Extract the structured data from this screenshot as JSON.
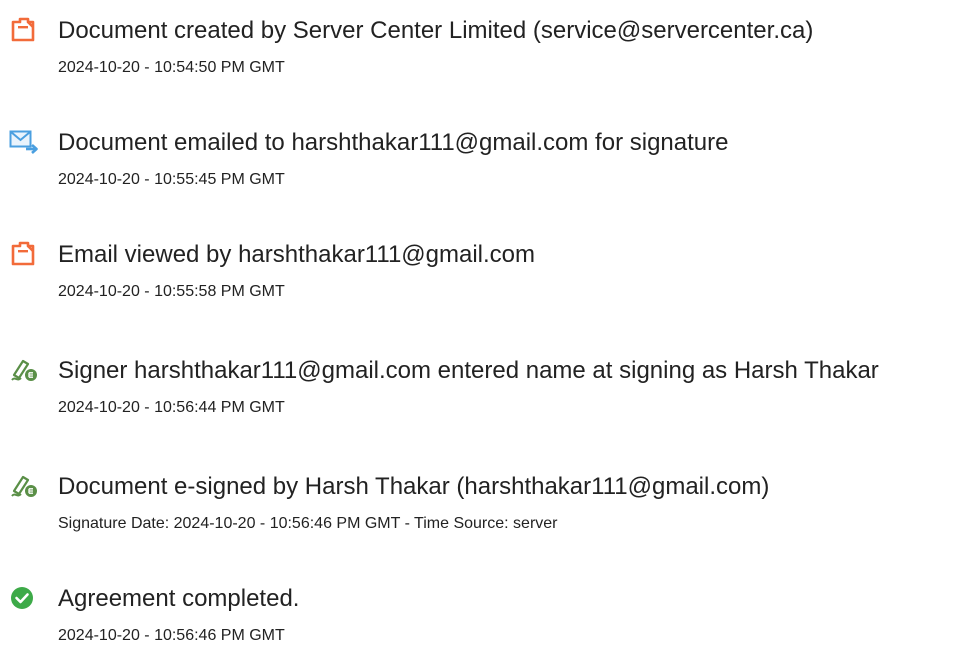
{
  "colors": {
    "document_icon": "#f26b3a",
    "email_icon": "#4a9fe0",
    "signature_icon": "#5a8f47",
    "check_icon": "#3daa48"
  },
  "events": [
    {
      "icon": "document-icon",
      "title": "Document created by Server Center Limited (service@servercenter.ca)",
      "meta": "2024-10-20 - 10:54:50 PM GMT"
    },
    {
      "icon": "email-sent-icon",
      "title": "Document emailed to harshthakar111@gmail.com for signature",
      "meta": "2024-10-20 - 10:55:45 PM GMT"
    },
    {
      "icon": "document-icon",
      "title": "Email viewed by harshthakar111@gmail.com",
      "meta": "2024-10-20 - 10:55:58 PM GMT"
    },
    {
      "icon": "signature-pen-icon",
      "title": "Signer harshthakar111@gmail.com entered name at signing as Harsh Thakar",
      "meta": "2024-10-20 - 10:56:44 PM GMT"
    },
    {
      "icon": "signature-pen-icon",
      "title": "Document e-signed by Harsh Thakar (harshthakar111@gmail.com)",
      "meta": "Signature Date: 2024-10-20 - 10:56:46 PM GMT - Time Source: server"
    },
    {
      "icon": "check-circle-icon",
      "title": "Agreement completed.",
      "meta": "2024-10-20 - 10:56:46 PM GMT"
    }
  ]
}
